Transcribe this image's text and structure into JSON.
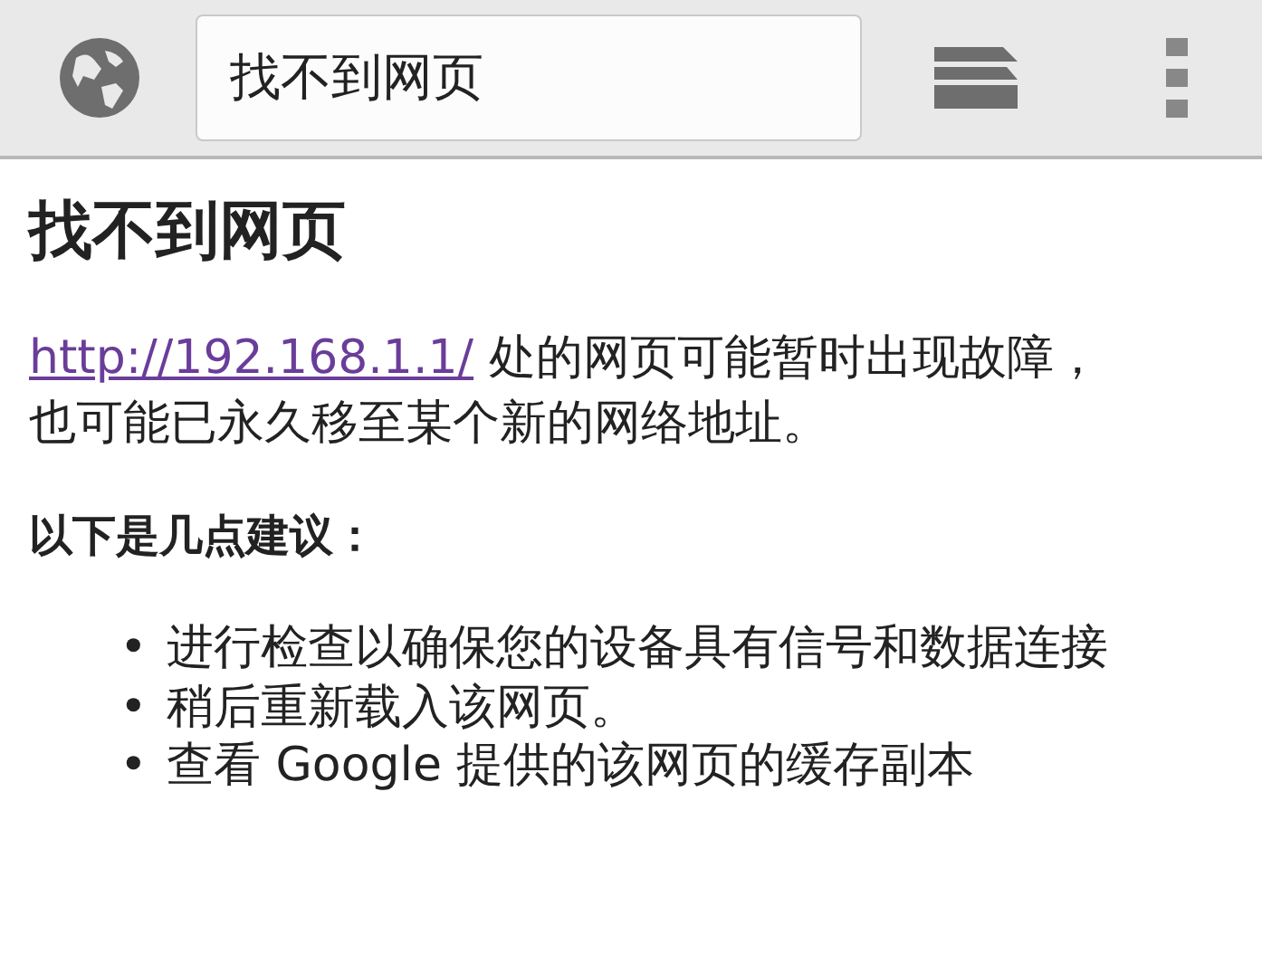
{
  "toolbar": {
    "address": "找不到网页"
  },
  "heading": "找不到网页",
  "message": {
    "link": "http://192.168.1.1/",
    "text": " 处的网页可能暂时出现故障，也可能已永久移至某个新的网络地址。"
  },
  "suggestions_title": "以下是几点建议：",
  "suggestions": [
    {
      "bullet": "•",
      "text": "进行检查以确保您的设备具有信号和数据连接"
    },
    {
      "bullet": "•",
      "text": "稍后重新载入该网页。"
    },
    {
      "bullet": "•",
      "text": "查看 Google 提供的该网页的缓存副本"
    }
  ]
}
